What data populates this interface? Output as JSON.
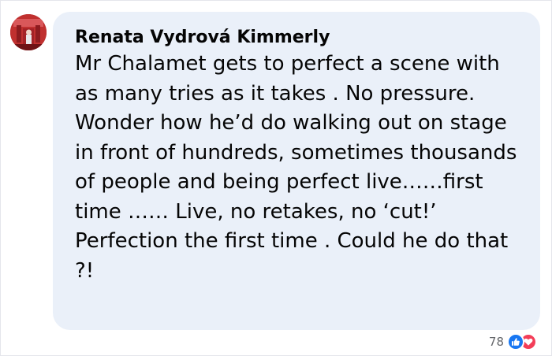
{
  "comment": {
    "author": "Renata Vydrová Kimmerly",
    "paragraphs": [
      "Mr Chalamet gets to perfect a scene with as many tries as it takes . No pressure.",
      "Wonder how he’d do walking out on stage in front of hundreds, sometimes thousands of people and being perfect live……first time …… Live, no retakes, no ‘cut!’ Perfection the first time . Could he do that ?!"
    ]
  },
  "reactions": {
    "count": "78",
    "types": [
      "like-icon",
      "love-icon"
    ],
    "colors": {
      "like": "#1877f2",
      "love": "#f33e58"
    }
  },
  "colors": {
    "bubble": "#eaf0f9",
    "text": "#050505",
    "meta": "#65676b"
  }
}
